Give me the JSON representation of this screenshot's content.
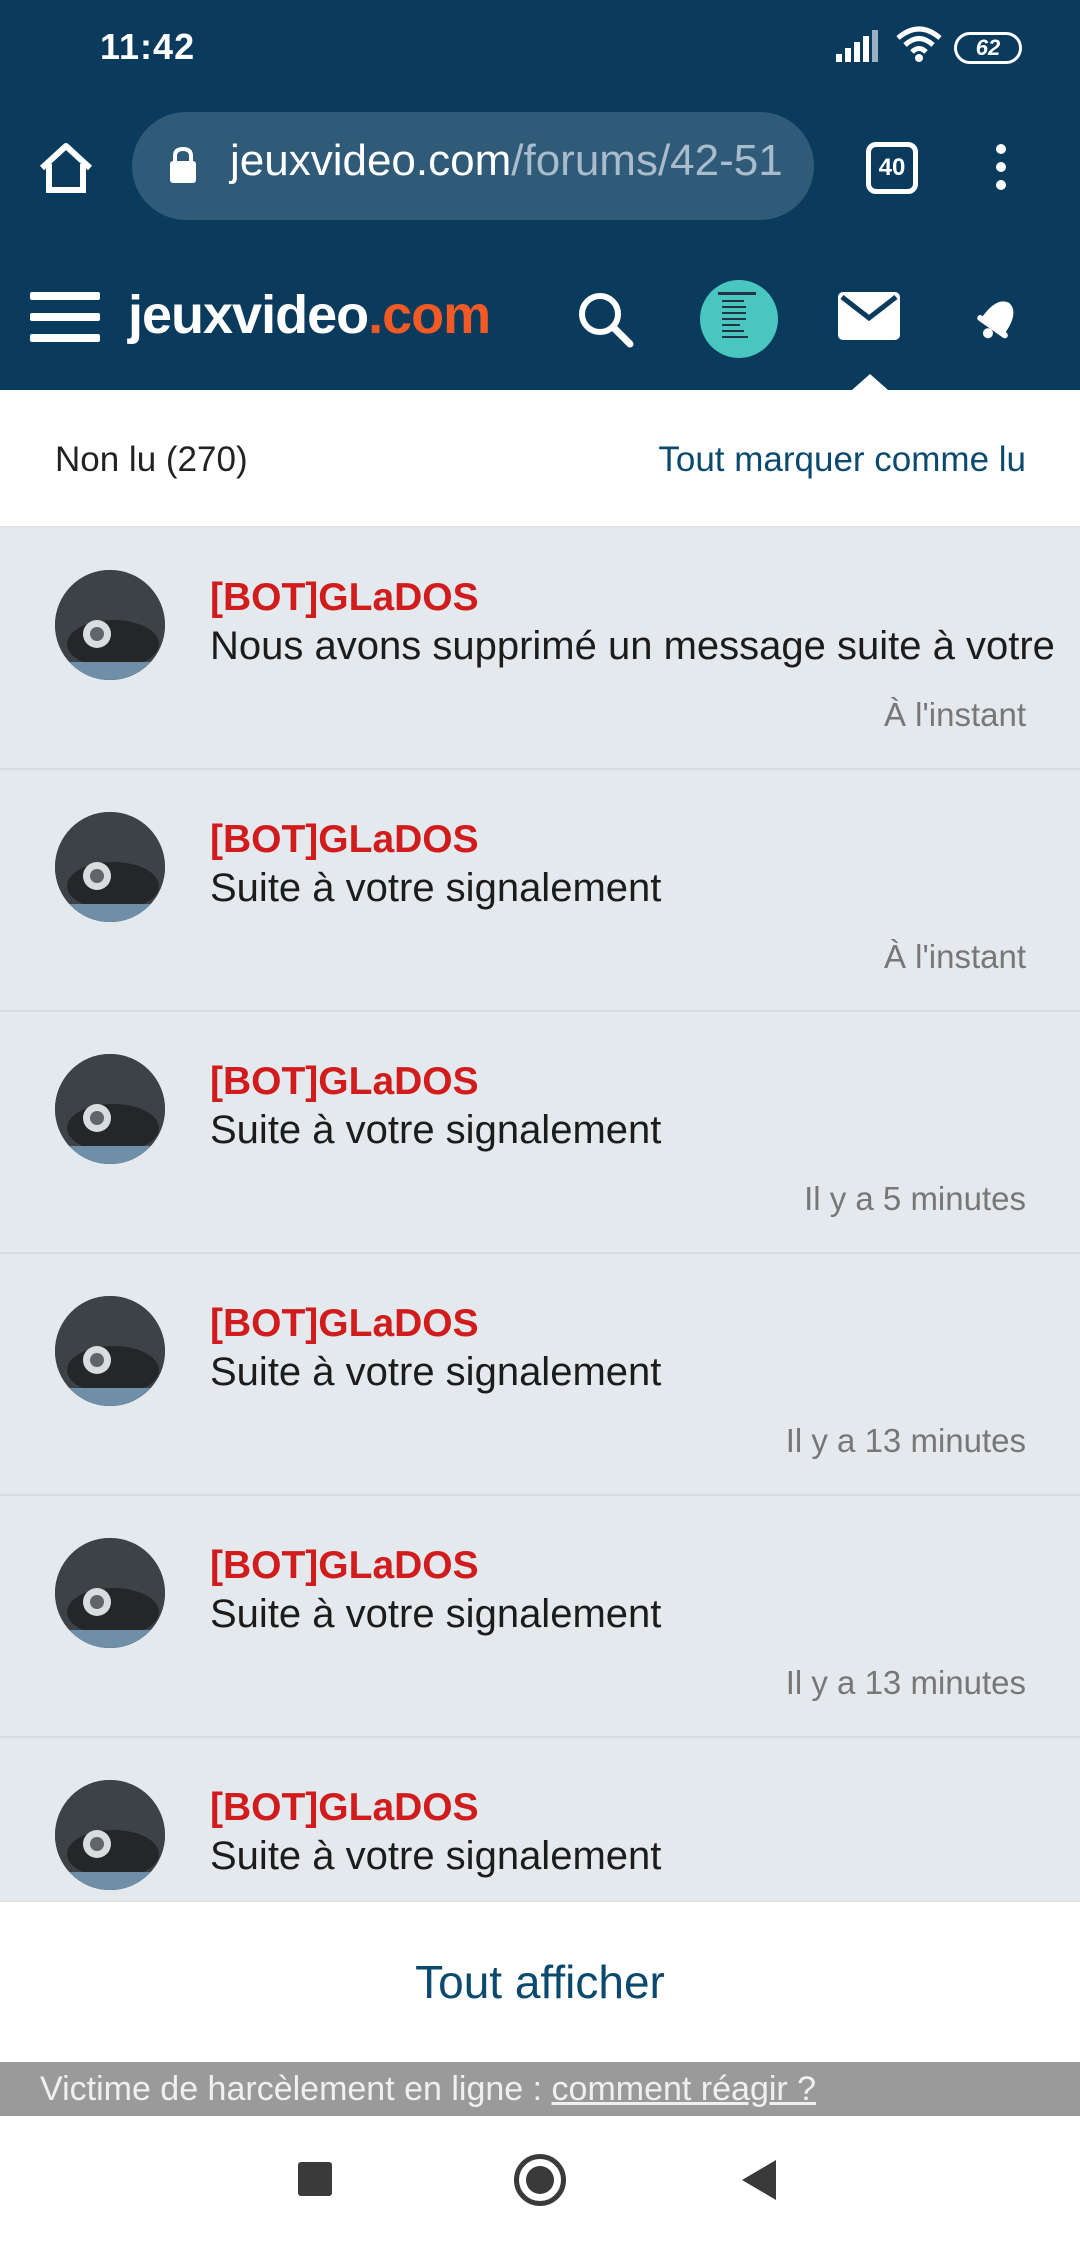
{
  "status_bar": {
    "time": "11:42",
    "battery": "62"
  },
  "browser": {
    "url_domain": "jeuxvideo.com",
    "url_path": "/forums/42-51",
    "tab_count": "40"
  },
  "site": {
    "logo_main": "jeuxvideo",
    "logo_suffix": ".com"
  },
  "unread": {
    "count_label": "Non lu (270)",
    "mark_all_label": "Tout marquer comme lu"
  },
  "notifications": [
    {
      "sender": "[BOT]GLaDOS",
      "message": "Nous avons supprimé un message suite à votre",
      "time": "À l'instant"
    },
    {
      "sender": "[BOT]GLaDOS",
      "message": "Suite à votre signalement",
      "time": "À l'instant"
    },
    {
      "sender": "[BOT]GLaDOS",
      "message": "Suite à votre signalement",
      "time": "Il y a 5 minutes"
    },
    {
      "sender": "[BOT]GLaDOS",
      "message": "Suite à votre signalement",
      "time": "Il y a 13 minutes"
    },
    {
      "sender": "[BOT]GLaDOS",
      "message": "Suite à votre signalement",
      "time": "Il y a 13 minutes"
    },
    {
      "sender": "[BOT]GLaDOS",
      "message": "Suite à votre signalement",
      "time": ""
    }
  ],
  "show_all_label": "Tout afficher",
  "harassment": {
    "text": "Victime de harcèlement en ligne : ",
    "link": "comment réagir ?"
  },
  "colors": {
    "header_bg": "#0b3b5c",
    "accent_orange": "#f15a24",
    "sender_red": "#d01c1c",
    "link_blue": "#0b4a6e",
    "list_bg": "#e4e9ee"
  }
}
